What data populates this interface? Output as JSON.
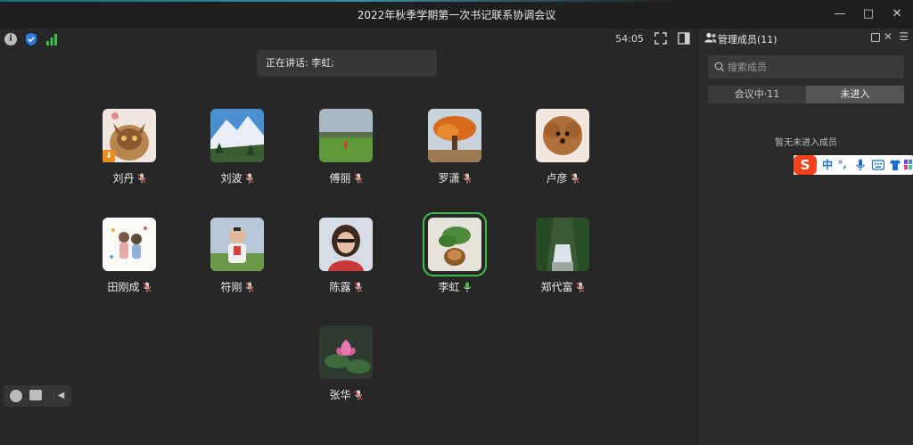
{
  "window": {
    "title": "2022年秋季学期第一次书记联系协调会议",
    "minimize": "—",
    "maximize": "□",
    "close": "✕"
  },
  "toolbar": {
    "info": "i",
    "timer": "54:05"
  },
  "speaking_banner": "正在讲话: 李虹;",
  "participants": [
    {
      "name": "刘丹"
    },
    {
      "name": "刘波"
    },
    {
      "name": "傅丽"
    },
    {
      "name": "罗潇"
    },
    {
      "name": "卢彦"
    },
    {
      "name": "田刚成"
    },
    {
      "name": "符刚"
    },
    {
      "name": "陈露"
    },
    {
      "name": "李虹",
      "speaking": true
    },
    {
      "name": "郑代富"
    },
    {
      "name": "张华"
    }
  ],
  "panel": {
    "title": "管理成员(11)",
    "close": "✕",
    "menu": "☰",
    "search_placeholder": "搜索成员",
    "tabs": [
      {
        "label": "会议中·11"
      },
      {
        "label": "未进入"
      }
    ],
    "active_tab": 1,
    "empty_text": "暂无未进入成员"
  },
  "ime": {
    "logo": "S",
    "chinese": "中",
    "punct": "°,"
  },
  "colors": {
    "speaking_outline": "#3bc14a",
    "mic_active": "#3bc14a",
    "badge": "#f08c1a",
    "ime_logo": "#f3421b"
  }
}
